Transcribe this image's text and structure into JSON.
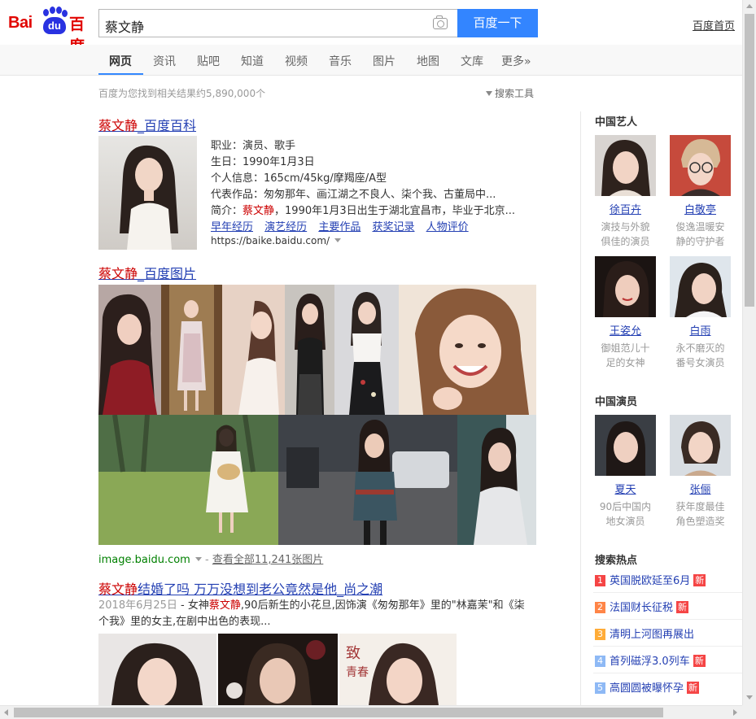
{
  "header": {
    "logo_text_latin": "Bai",
    "logo_text_paw": "du",
    "logo_text_cn": "百度",
    "query": "蔡文静",
    "search_button": "百度一下",
    "home_link": "百度首页"
  },
  "nav": {
    "tabs": [
      {
        "label": "网页",
        "active": true
      },
      {
        "label": "资讯"
      },
      {
        "label": "贴吧"
      },
      {
        "label": "知道"
      },
      {
        "label": "视频"
      },
      {
        "label": "音乐"
      },
      {
        "label": "图片"
      },
      {
        "label": "地图"
      },
      {
        "label": "文库"
      },
      {
        "label": "更多»"
      }
    ]
  },
  "result_count": "百度为您找到相关结果约5,890,000个",
  "search_tools": "搜索工具",
  "results": {
    "baike": {
      "title_highlight": "蔡文静",
      "title_rest": "_百度百科",
      "fields": [
        "职业：演员、歌手",
        "生日：1990年1月3日",
        "个人信息：165cm/45kg/摩羯座/A型",
        "代表作品：匆匆那年、画江湖之不良人、柒个我、古董局中...",
        "简介：",
        "蔡文静",
        "，1990年1月3日出生于湖北宜昌市，毕业于北京..."
      ],
      "links": [
        "早年经历",
        "演艺经历",
        "主要作品",
        "获奖记录",
        "人物评价"
      ],
      "url": "https://baike.baidu.com/"
    },
    "images": {
      "title_highlight": "蔡文静",
      "title_rest": "_百度图片",
      "source": "image.baidu.com",
      "view_all": "查看全部11,241张图片"
    },
    "news": {
      "title_highlight": "蔡文静",
      "title_rest": "结婚了吗 万万没想到老公竟然是他_尚之潮",
      "date": "2018年6月25日",
      "snippet_before": " - 女神",
      "snippet_highlight": "蔡文静",
      "snippet_after": ",90后新生的小花旦,因饰演《匆匆那年》里的\"林嘉茉\"和《柒个我》里的女主,在剧中出色的表现..."
    }
  },
  "sidebar": {
    "section1_title": "中国艺人",
    "section1_people": [
      {
        "name": "徐百卉",
        "desc1": "演技与外貌",
        "desc2": "俱佳的演员"
      },
      {
        "name": "白敬亭",
        "desc1": "俊逸温暖安",
        "desc2": "静的守护者"
      },
      {
        "name": "王姿允",
        "desc1": "御姐范儿十",
        "desc2": "足的女神"
      },
      {
        "name": "白雨",
        "desc1": "永不磨灭的",
        "desc2": "番号女演员"
      }
    ],
    "section2_title": "中国演员",
    "section2_people": [
      {
        "name": "夏天",
        "desc1": "90后中国内",
        "desc2": "地女演员"
      },
      {
        "name": "张俪",
        "desc1": "获年度最佳",
        "desc2": "角色塑造奖"
      }
    ],
    "hot_title": "搜索热点",
    "hot_items": [
      {
        "rank": "1",
        "text": "英国脱欧延至6月",
        "new": "新"
      },
      {
        "rank": "2",
        "text": "法国财长征税",
        "new": "新"
      },
      {
        "rank": "3",
        "text": "清明上河图再展出"
      },
      {
        "rank": "4",
        "text": "首列磁浮3.0列车",
        "new": "新"
      },
      {
        "rank": "5",
        "text": "高圆圆被曝怀孕",
        "new": "新"
      }
    ]
  },
  "colors": {
    "brand_red": "#e10602",
    "brand_blue": "#2932e1",
    "search_button": "#3385ff",
    "link": "#2440b3",
    "highlight": "#c00",
    "url_green": "#008000"
  }
}
